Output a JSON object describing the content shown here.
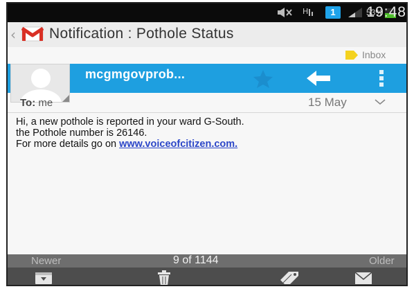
{
  "status_bar": {
    "battery_percent": "53%",
    "time": "19:48",
    "notification_badge": "1",
    "icons": [
      "mute-icon",
      "signal-h-icon",
      "notification-badge-icon",
      "cell-signal-icon",
      "battery-icon"
    ],
    "battery_color": "#4fbf2b",
    "badge_color": "#1fa3ea"
  },
  "action_bar": {
    "back_icon": "chevron-left-icon",
    "app_icon": "gmail-logo",
    "title": "Notification : Pothole Status"
  },
  "label_row": {
    "label_icon": "label-tag-icon",
    "label": "Inbox",
    "tag_color": "#f4d21f"
  },
  "sender": {
    "name": "mcgmgovprob...",
    "bar_color": "#1e9fe0",
    "icons": [
      "avatar",
      "star-icon",
      "reply-icon",
      "overflow-menu-icon"
    ]
  },
  "recipient_row": {
    "to_label": "To:",
    "to_value": "me",
    "date": "15 May",
    "expand_icon": "chevron-down-icon"
  },
  "message": {
    "line1": "Hi, a new pothole is reported in your ward G-South.",
    "line2": "the Pothole number is 26146.",
    "line3_prefix": "For more details go on ",
    "link_text": "www.voiceofcitizen.com."
  },
  "pager": {
    "newer": "Newer",
    "count": "9 of 1144",
    "older": "Older"
  },
  "bottom_toolbar": {
    "icons": [
      "archive-icon",
      "trash-icon",
      "label-icon",
      "mark-unread-icon"
    ]
  }
}
